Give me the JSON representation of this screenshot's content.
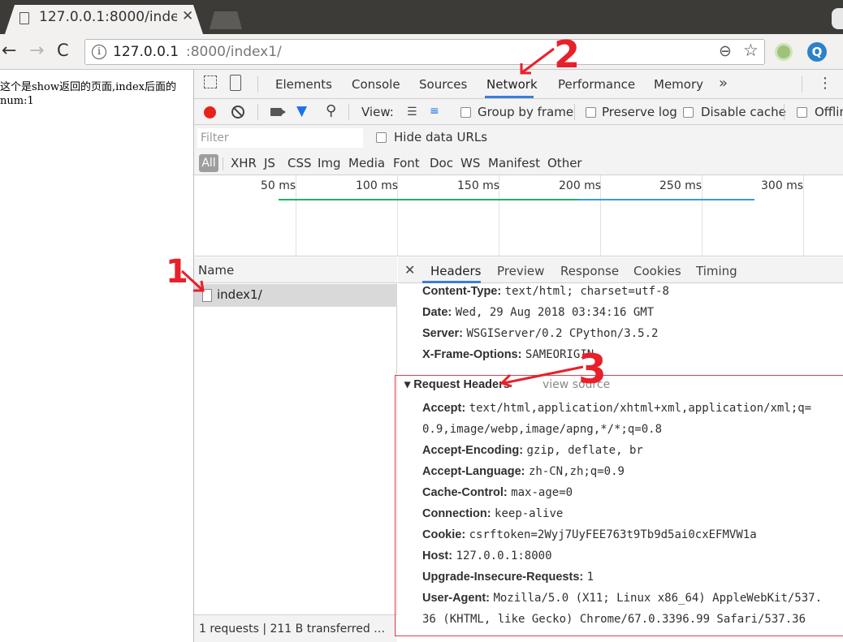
{
  "browser": {
    "tab_title": "127.0.0.1:8000/inde",
    "url_host": "127.0.0.1",
    "url_rest": ":8000/index1/"
  },
  "page": {
    "line1": "这个是show返回的页面,index后面的",
    "line2": "num:1"
  },
  "devtools": {
    "panels": [
      "Elements",
      "Console",
      "Sources",
      "Network",
      "Performance",
      "Memory"
    ],
    "active_panel": "Network",
    "controls": {
      "view_label": "View:",
      "group_by_frame": "Group by frame",
      "preserve_log": "Preserve log",
      "disable_cache": "Disable cache",
      "offline": "Offlin"
    },
    "filter": {
      "placeholder": "Filter",
      "hide_data_urls": "Hide data URLs",
      "all_label": "All",
      "types": [
        "XHR",
        "JS",
        "CSS",
        "Img",
        "Media",
        "Font",
        "Doc",
        "WS",
        "Manifest",
        "Other"
      ]
    },
    "timeline": {
      "ticks": [
        "50 ms",
        "100 ms",
        "150 ms",
        "200 ms",
        "250 ms",
        "300 ms"
      ],
      "colors": {
        "waiting": "#1fb26b",
        "download": "#3b9ae0"
      }
    },
    "requests": {
      "column_name": "Name",
      "items": [
        "index1/"
      ],
      "status": "1 requests  |  211 B transferred …"
    },
    "details": {
      "tabs": [
        "Headers",
        "Preview",
        "Response",
        "Cookies",
        "Timing"
      ],
      "active_tab": "Headers",
      "response_headers": [
        {
          "key": "Content-Type:",
          "value": "text/html; charset=utf-8"
        },
        {
          "key": "Date:",
          "value": "Wed, 29 Aug 2018 03:34:16 GMT"
        },
        {
          "key": "Server:",
          "value": "WSGIServer/0.2 CPython/3.5.2"
        },
        {
          "key": "X-Frame-Options:",
          "value": "SAMEORIGIN"
        }
      ],
      "request_headers_title": "▾ Request Headers",
      "view_source": "view source",
      "request_headers": [
        {
          "key": "Accept:",
          "value": "text/html,application/xhtml+xml,application/xml;q=",
          "cont": "0.9,image/webp,image/apng,*/*;q=0.8"
        },
        {
          "key": "Accept-Encoding:",
          "value": "gzip, deflate, br"
        },
        {
          "key": "Accept-Language:",
          "value": "zh-CN,zh;q=0.9"
        },
        {
          "key": "Cache-Control:",
          "value": "max-age=0"
        },
        {
          "key": "Connection:",
          "value": "keep-alive"
        },
        {
          "key": "Cookie:",
          "value": "csrftoken=2Wyj7UyFEE763t9Tb9d5ai0cxEFMVW1a"
        },
        {
          "key": "Host:",
          "value": "127.0.0.1:8000"
        },
        {
          "key": "Upgrade-Insecure-Requests:",
          "value": "1"
        },
        {
          "key": "User-Agent:",
          "value": "Mozilla/5.0 (X11; Linux x86_64) AppleWebKit/537.",
          "cont": "36 (KHTML, like Gecko) Chrome/67.0.3396.99 Safari/537.36"
        }
      ]
    }
  },
  "annotations": {
    "mark1": "1",
    "mark2": "2",
    "mark3": "3",
    "color": "#e8202a"
  }
}
